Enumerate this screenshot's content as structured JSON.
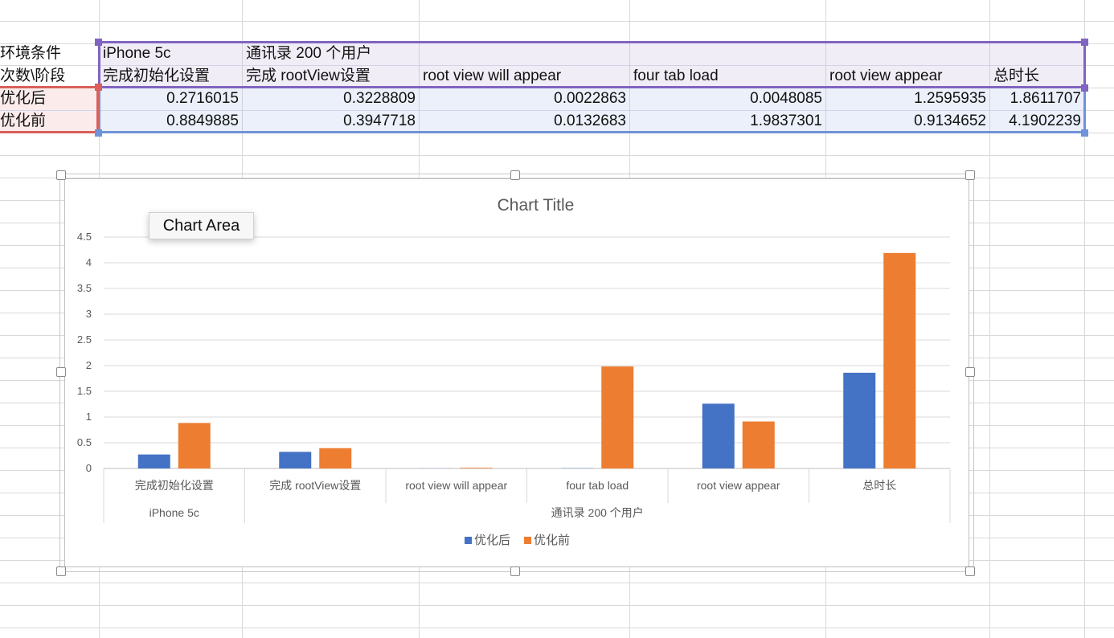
{
  "sheet": {
    "row_headers": [
      "环境条件",
      "次数\\阶段",
      "优化后",
      "优化前"
    ],
    "device": "iPhone 5c",
    "condition": "通讯录 200 个用户",
    "stages": [
      "完成初始化设置",
      "完成 rootView设置",
      "root view will appear",
      "four tab load",
      "root view appear",
      "总时长"
    ],
    "row_after": [
      "0.2716015",
      "0.3228809",
      "0.0022863",
      "0.0048085",
      "1.2595935",
      "1.8611707"
    ],
    "row_before": [
      "0.8849885",
      "0.3947718",
      "0.0132683",
      "1.9837301",
      "0.9134652",
      "4.1902239"
    ]
  },
  "tooltip": {
    "text": "Chart Area"
  },
  "chart_data": {
    "type": "bar",
    "title": "Chart Title",
    "categories": [
      "完成初始化设置",
      "完成 rootView设置",
      "root view will appear",
      "four tab load",
      "root view appear",
      "总时长"
    ],
    "category_groups": [
      {
        "label": "iPhone 5c",
        "span": 1
      },
      {
        "label": "通讯录 200 个用户",
        "span": 5
      }
    ],
    "series": [
      {
        "name": "优化后",
        "color": "#4472c4",
        "values": [
          0.2716015,
          0.3228809,
          0.0022863,
          0.0048085,
          1.2595935,
          1.8611707
        ]
      },
      {
        "name": "优化前",
        "color": "#ed7d31",
        "values": [
          0.8849885,
          0.3947718,
          0.0132683,
          1.9837301,
          0.9134652,
          4.1902239
        ]
      }
    ],
    "ylim": [
      0,
      4.5
    ],
    "yticks": [
      0,
      0.5,
      1,
      1.5,
      2,
      2.5,
      3,
      3.5,
      4,
      4.5
    ],
    "grid": true,
    "legend": "bottom"
  },
  "colors": {
    "purple_selection": "#8064c0",
    "blue_selection": "#6f93d8",
    "red_selection": "#d9605a",
    "purple_fill": "#f1edf7",
    "blue_fill": "#ebf0fa",
    "red_fill": "#fbeceb"
  }
}
